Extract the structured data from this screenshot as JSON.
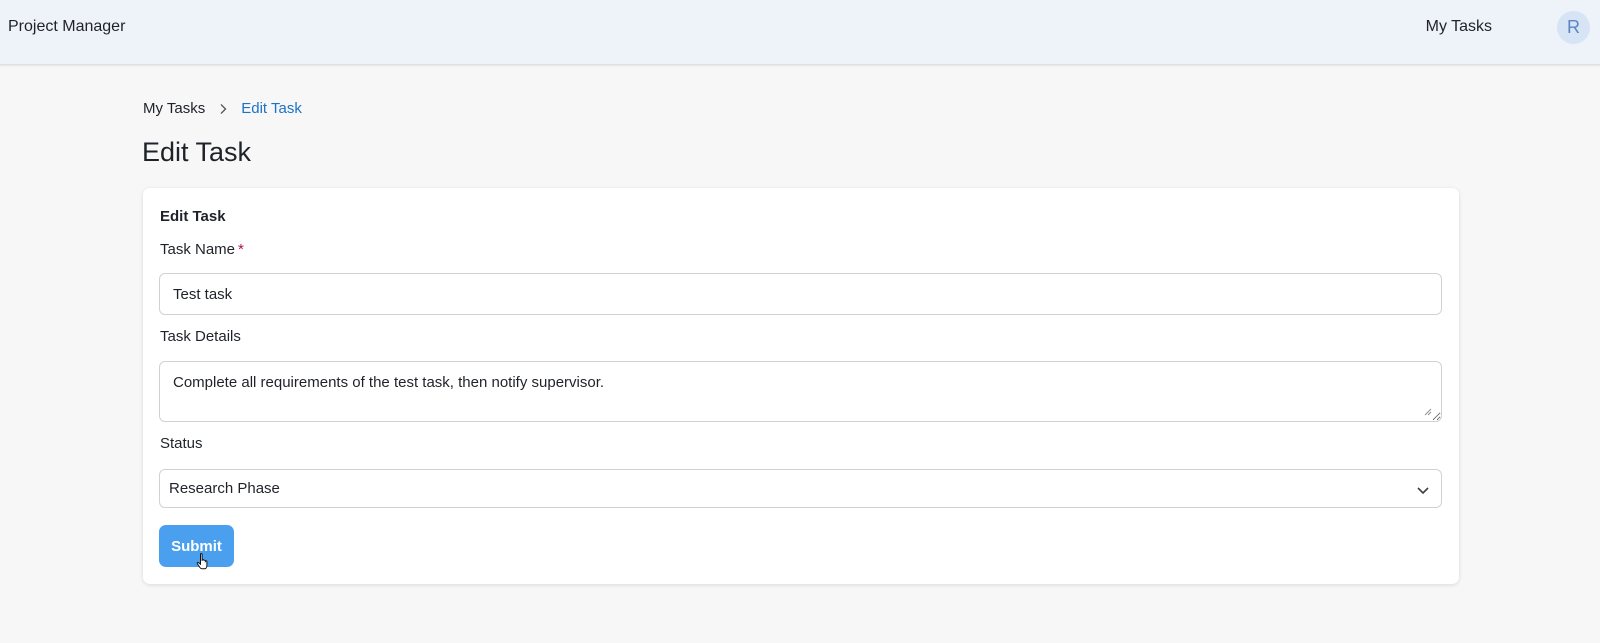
{
  "app": {
    "title": "Project Manager"
  },
  "nav": {
    "my_tasks": "My Tasks",
    "avatar_initial": "R"
  },
  "breadcrumb": {
    "parent": "My Tasks",
    "current": "Edit Task"
  },
  "page": {
    "title": "Edit Task"
  },
  "form": {
    "title": "Edit Task",
    "task_name": {
      "label": "Task Name",
      "required_mark": "*",
      "value": "Test task"
    },
    "task_details": {
      "label": "Task Details",
      "value": "Complete all requirements of the test task, then notify supervisor."
    },
    "status": {
      "label": "Status",
      "selected": "Research Phase"
    },
    "submit_label": "Submit"
  },
  "colors": {
    "accent": "#4a9fef",
    "link": "#1c73c5",
    "topbar_bg": "#eef2f9",
    "required": "#b0124b"
  },
  "icons": {
    "breadcrumb_separator": "chevron-right-icon",
    "select": "chevron-down-icon",
    "cursor": "hand-pointer-icon"
  }
}
